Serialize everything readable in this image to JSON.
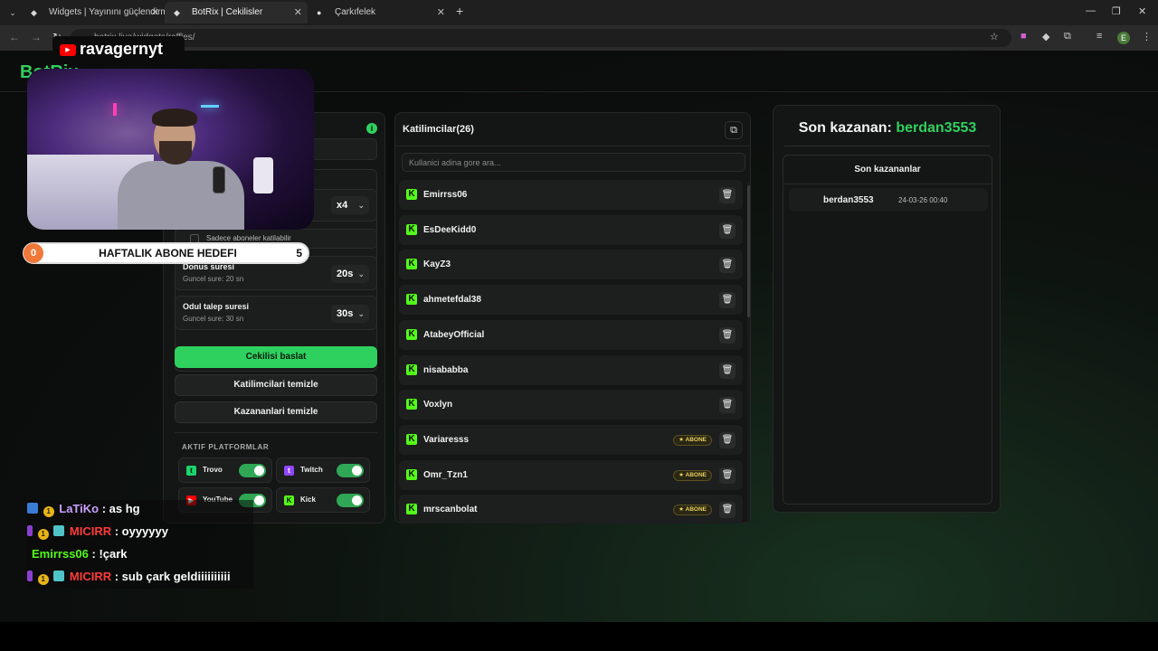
{
  "browser": {
    "tabs": [
      {
        "title": "Widgets | Yayınını güçlendirme",
        "icon": "botrix-icon",
        "active": false
      },
      {
        "title": "BotRix | Cekilisler",
        "icon": "botrix-icon",
        "active": true
      },
      {
        "title": "Çarkıfelek",
        "icon": "chrome-icon",
        "active": false
      }
    ],
    "url": "botrix.live/widgets/raffles/",
    "profile_initial": "E"
  },
  "stream_overlay": {
    "channel_name": "ravagernyt",
    "sub_goal": {
      "title": "HAFTALIK ABONE HEDEFI",
      "current": "0",
      "target": "5",
      "progress": 0
    },
    "chat": [
      {
        "user": "LaTiKo",
        "message": ": as hg",
        "color": "#c9a0ff"
      },
      {
        "user": "MICIRR",
        "message": ": oyyyyyy",
        "color": "#ff3b3b"
      },
      {
        "user": "Emirrss06",
        "message": ": !çark",
        "color": "#53fc18"
      },
      {
        "user": "MICIRR",
        "message": ": sub çark geldiiiiiiiiii",
        "color": "#ff3b3b"
      }
    ]
  },
  "app": {
    "logo": "BotRix"
  },
  "settings": {
    "multiplier_value": "x4",
    "subs_only_label": "Sadece aboneler katilabilir",
    "spin_duration": {
      "title": "Donus suresi",
      "sub": "Guncel sure: 20 sn",
      "value": "20s"
    },
    "claim_duration": {
      "title": "Odul talep suresi",
      "sub": "Guncel sure: 30 sn",
      "value": "30s"
    },
    "start_button": "Cekilisi baslat",
    "clear_participants_button": "Katilimcilari temizle",
    "clear_winners_button": "Kazananlari temizle",
    "platforms_title": "AKTIF PLATFORMLAR",
    "platforms": [
      {
        "name": "Trovo",
        "enabled": true,
        "color": "#19d66b"
      },
      {
        "name": "Twitch",
        "enabled": true,
        "color": "#9146ff"
      },
      {
        "name": "YouTube",
        "enabled": true,
        "color": "#ff0000"
      },
      {
        "name": "Kick",
        "enabled": true,
        "color": "#53fc18"
      }
    ]
  },
  "participants": {
    "title": "Katilimcilar",
    "count": "(26)",
    "search_placeholder": "Kullanici adina gore ara...",
    "subscriber_badge": "ABONE",
    "items": [
      {
        "name": "Emirrss06",
        "subscriber": false
      },
      {
        "name": "EsDeeKidd0",
        "subscriber": false
      },
      {
        "name": "KayZ3",
        "subscriber": false
      },
      {
        "name": "ahmetefdal38",
        "subscriber": false
      },
      {
        "name": "AtabeyOfficial",
        "subscriber": false
      },
      {
        "name": "nisababba",
        "subscriber": false
      },
      {
        "name": "Voxlyn",
        "subscriber": false
      },
      {
        "name": "Variaresss",
        "subscriber": true
      },
      {
        "name": "Omr_Tzn1",
        "subscriber": true
      },
      {
        "name": "mrscanbolat",
        "subscriber": true
      }
    ]
  },
  "winners": {
    "last_winner_label": "Son kazanan:",
    "last_winner_name": "berdan3553",
    "list_title": "Son kazananlar",
    "items": [
      {
        "name": "berdan3553",
        "date": "24-03-26 00:40"
      }
    ]
  },
  "colors": {
    "accent": "#2fd15e",
    "kick": "#53fc18",
    "badge": "#e8cf5c"
  }
}
